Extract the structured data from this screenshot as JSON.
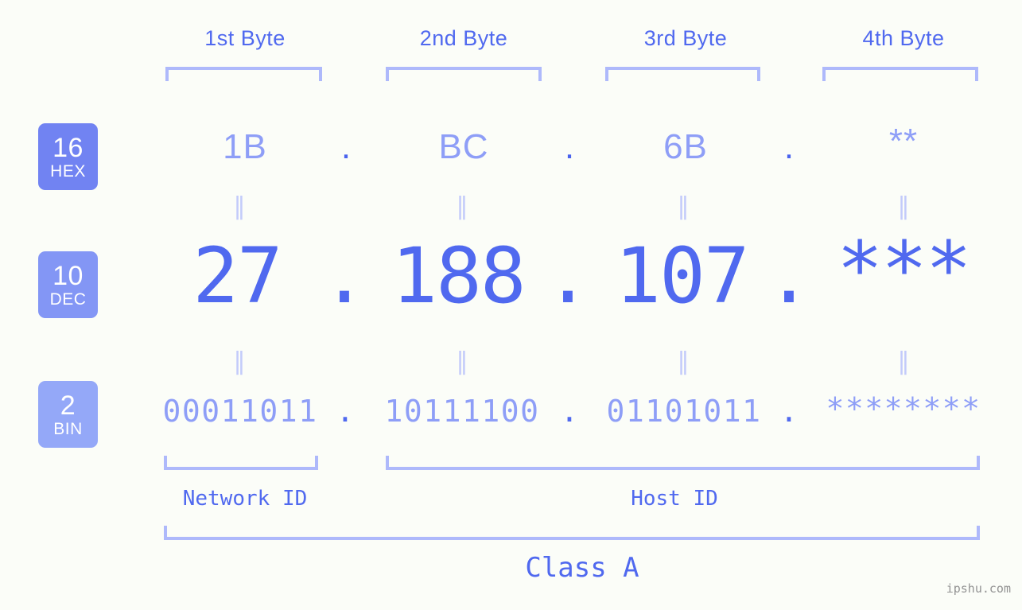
{
  "page": {
    "background_color": "#fbfdf8",
    "accent_color": "#5069ef",
    "accent_light_color": "#8e9ef7",
    "bracket_color": "#aeb9fb",
    "watermark": "ipshu.com"
  },
  "byte_headers": [
    {
      "label": "1st Byte"
    },
    {
      "label": "2nd Byte"
    },
    {
      "label": "3rd Byte"
    },
    {
      "label": "4th Byte"
    }
  ],
  "bases": [
    {
      "radix": "16",
      "name": "HEX",
      "color": "#7183f2"
    },
    {
      "radix": "10",
      "name": "DEC",
      "color": "#8396f5"
    },
    {
      "radix": "2",
      "name": "BIN",
      "color": "#94a8f8"
    }
  ],
  "rows": {
    "hex": {
      "values": [
        "1B",
        "BC",
        "6B",
        "**"
      ],
      "separator": "."
    },
    "dec": {
      "values": [
        "27",
        "188",
        "107",
        "***"
      ],
      "separator": "."
    },
    "bin": {
      "values": [
        "00011011",
        "10111100",
        "01101011",
        "********"
      ],
      "separator": "."
    }
  },
  "equality_marks": {
    "glyph": "‖",
    "count_per_row": 4
  },
  "regions": {
    "network_id": "Network ID",
    "host_id": "Host ID",
    "ip_class": "Class A"
  }
}
